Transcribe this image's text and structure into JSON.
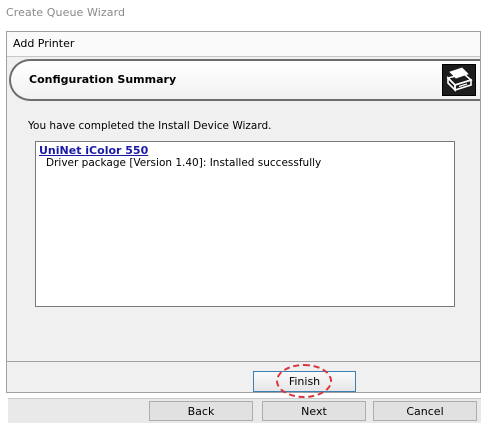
{
  "window": {
    "title": "Create Queue Wizard"
  },
  "dialog": {
    "title": "Add Printer",
    "banner_title": "Configuration Summary",
    "banner_icon": "printer-icon",
    "intro": "You have completed the Install Device Wizard.",
    "summary": {
      "printer_name": "UniNet iColor 550",
      "driver_line": "Driver package [Version 1.40]: Installed successfully"
    },
    "finish_label": "Finish"
  },
  "outer_buttons": {
    "back_label": "Back",
    "next_label": "Next",
    "cancel_label": "Cancel"
  },
  "colors": {
    "link": "#1a1aa6",
    "highlight": "#d9343b",
    "focus_border": "#3c7fb1"
  }
}
